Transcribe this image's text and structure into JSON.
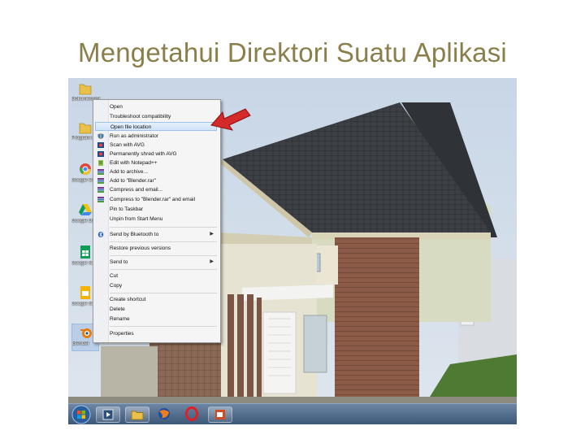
{
  "slide": {
    "title": "Mengetahui Direktori Suatu Aplikasi"
  },
  "desktop_icons": [
    {
      "label": "Dokumentasi",
      "icon": "folder-icon"
    },
    {
      "label": "Program Luaran",
      "icon": "folder-icon"
    },
    {
      "label": "Google Chrome",
      "icon": "chrome-icon"
    },
    {
      "label": "Google Drive",
      "icon": "drive-icon"
    },
    {
      "label": "Google Sheets",
      "icon": "sheets-icon"
    },
    {
      "label": "Google Slides",
      "icon": "slides-icon"
    },
    {
      "label": "Blender",
      "icon": "blender-icon"
    }
  ],
  "context_menu": {
    "items": [
      {
        "label": "Open",
        "icon": "",
        "highlight": false,
        "submenu": false
      },
      {
        "label": "Troubleshoot compatibility",
        "icon": "",
        "highlight": false,
        "submenu": false
      },
      {
        "label": "Open file location",
        "icon": "",
        "highlight": true,
        "submenu": false
      },
      {
        "label": "Run as administrator",
        "icon": "shield-icon",
        "highlight": false,
        "submenu": false
      },
      {
        "label": "Scan with AVG",
        "icon": "avg-icon",
        "highlight": false,
        "submenu": false
      },
      {
        "label": "Permanently shred with AVG",
        "icon": "avg-icon",
        "highlight": false,
        "submenu": false
      },
      {
        "label": "Edit with Notepad++",
        "icon": "notepad-icon",
        "highlight": false,
        "submenu": false
      },
      {
        "label": "Add to archive...",
        "icon": "archive-icon",
        "highlight": false,
        "submenu": false
      },
      {
        "label": "Add to \"Blender.rar\"",
        "icon": "archive-icon",
        "highlight": false,
        "submenu": false
      },
      {
        "label": "Compress and email...",
        "icon": "archive-icon",
        "highlight": false,
        "submenu": false
      },
      {
        "label": "Compress to \"Blender.rar\" and email",
        "icon": "archive-icon",
        "highlight": false,
        "submenu": false
      },
      {
        "label": "Pin to Taskbar",
        "icon": "",
        "highlight": false,
        "submenu": false
      },
      {
        "label": "Unpin from Start Menu",
        "icon": "",
        "highlight": false,
        "submenu": false
      },
      {
        "label": "Send by Bluetooth to",
        "icon": "bluetooth-icon",
        "highlight": false,
        "submenu": true
      },
      {
        "label": "Restore previous versions",
        "icon": "",
        "highlight": false,
        "submenu": false
      },
      {
        "label": "Send to",
        "icon": "",
        "highlight": false,
        "submenu": true
      },
      {
        "label": "Cut",
        "icon": "",
        "highlight": false,
        "submenu": false
      },
      {
        "label": "Copy",
        "icon": "",
        "highlight": false,
        "submenu": false
      },
      {
        "label": "Create shortcut",
        "icon": "",
        "highlight": false,
        "submenu": false
      },
      {
        "label": "Delete",
        "icon": "",
        "highlight": false,
        "submenu": false
      },
      {
        "label": "Rename",
        "icon": "",
        "highlight": false,
        "submenu": false
      },
      {
        "label": "Properties",
        "icon": "",
        "highlight": false,
        "submenu": false
      }
    ]
  },
  "taskbar": {
    "buttons": [
      "start-orb-icon",
      "media-player-icon",
      "explorer-icon",
      "firefox-icon",
      "opera-icon",
      "powerpoint-icon"
    ]
  },
  "colors": {
    "title": "#8a7f4a",
    "arrow": "#d42a2a",
    "taskbar": "#3b5676"
  }
}
